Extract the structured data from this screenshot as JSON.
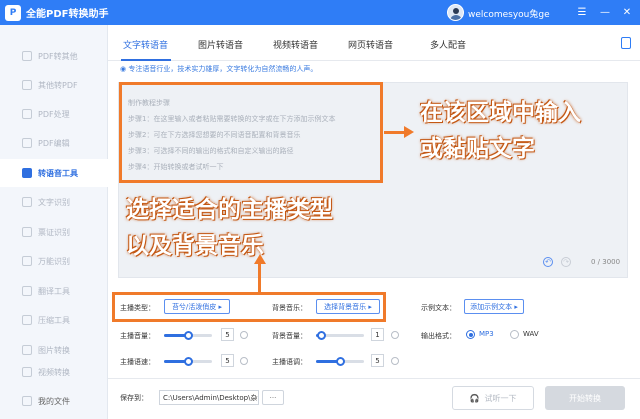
{
  "app": {
    "logo_text": "P",
    "title": "全能PDF转换助手",
    "username": "welcomesyou兔ge"
  },
  "window_controls": {
    "menu": "☰",
    "minimize": "—",
    "close": "✕"
  },
  "sidebar": {
    "items": [
      {
        "label": "PDF转其他"
      },
      {
        "label": "其他转PDF"
      },
      {
        "label": "PDF处理"
      },
      {
        "label": "PDF编辑"
      },
      {
        "label": "转语音工具"
      },
      {
        "label": "文字识别"
      },
      {
        "label": "票证识别"
      },
      {
        "label": "万能识别"
      },
      {
        "label": "翻译工具"
      },
      {
        "label": "压缩工具"
      },
      {
        "label": "图片转换"
      },
      {
        "label": "视频转换"
      }
    ],
    "active_index": 4,
    "bottom_item": "我的文件"
  },
  "tabs": [
    "文字转语音",
    "图片转语音",
    "视频转语音",
    "网页转语音",
    "多人配音"
  ],
  "tagline": "专注语音行业，技术实力雄厚，文字转化为自然流畅的人声。",
  "editor": {
    "steps": [
      "制作教程步骤",
      "步骤1：在这里输入或者粘贴需要转换的文字或在下方添加示例文本",
      "步骤2：可在下方选择您想要的不同语音配置和背景音乐",
      "步骤3：可选择不同的输出的格式和自定义输出的路径",
      "步骤4：开始转换或者试听一下"
    ],
    "counter": "0 / 3000",
    "undo_icon": "↶",
    "redo_icon": "↷"
  },
  "annotations": {
    "input_hint_line1": "在该区域中输入",
    "input_hint_line2": "或黏贴文字",
    "select_hint_line1": "选择适合的主播类型",
    "select_hint_line2": "以及背景音乐"
  },
  "settings": {
    "anchor_type_label": "主播类型：",
    "anchor_type_value": "苔兮/活泼俏皮 ▸",
    "bgm_label": "背景音乐：",
    "bgm_value": "选择背景音乐 ▸",
    "sample_label": "示例文本：",
    "sample_value": "添加示例文本 ▸",
    "anchor_volume_label": "主播音量：",
    "anchor_volume": "5",
    "anchor_volume_level": 0.5,
    "bgm_volume_label": "背景音量：",
    "bgm_volume": "1",
    "bgm_volume_level": 0.1,
    "anchor_speed_label": "主播语速：",
    "anchor_speed": "5",
    "anchor_speed_level": 0.5,
    "anchor_pitch_label": "主播语调：",
    "anchor_pitch": "5",
    "anchor_pitch_level": 0.5,
    "output_format_label": "输出格式：",
    "format_mp3": "MP3",
    "format_wav": "WAV",
    "selected_format": "MP3"
  },
  "footer": {
    "save_label": "保存到：",
    "save_path": "C:\\Users\\Admin\\Desktop\\杂",
    "more_icon": "···",
    "listen_button": "试听一下",
    "convert_button": "开始转换"
  },
  "colors": {
    "brand": "#2f7df6",
    "accent": "#2f6fe0",
    "annotation": "#f07a2a"
  }
}
